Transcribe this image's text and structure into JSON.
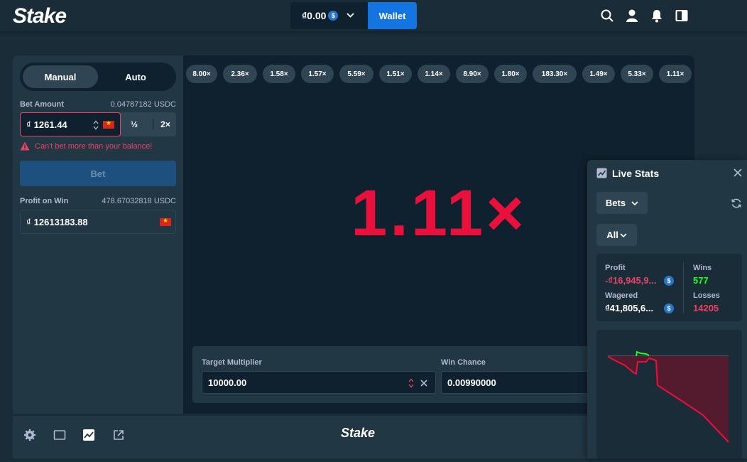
{
  "header": {
    "logo": "Stake",
    "balance": "₫0.00",
    "balance_coin": "$",
    "wallet_label": "Wallet"
  },
  "left_panel": {
    "mode_manual": "Manual",
    "mode_auto": "Auto",
    "bet_amount_label": "Bet Amount",
    "bet_amount_usdc": "0.04787182 USDC",
    "bet_currency_symbol": "₫",
    "bet_amount_value": "1261.44",
    "half_label": "½",
    "double_label": "2×",
    "error_text": "Can't bet more than your balance!",
    "bet_button": "Bet",
    "profit_label": "Profit on Win",
    "profit_usdc": "478.67032818 USDC",
    "profit_value": "12613183.88"
  },
  "game": {
    "recent_results": [
      "8.00×",
      "2.36×",
      "1.58×",
      "1.57×",
      "5.59×",
      "1.51×",
      "1.14×",
      "8.90×",
      "1.80×",
      "183.30×",
      "1.49×",
      "5.33×",
      "1.11×"
    ],
    "current_multiplier": "1.11×",
    "target_multiplier_label": "Target Multiplier",
    "target_multiplier_value": "10000.00",
    "win_chance_label": "Win Chance",
    "win_chance_value": "0.00990000"
  },
  "footer": {
    "logo": "Stake"
  },
  "live_stats": {
    "title": "Live Stats",
    "bets_dropdown": "Bets",
    "filter_dropdown": "All",
    "profit_label": "Profit",
    "profit_value": "-₫16,945,9...",
    "wagered_label": "Wagered",
    "wagered_value": "₫41,805,6...",
    "coin": "$",
    "wins_label": "Wins",
    "wins_value": "577",
    "losses_label": "Losses",
    "losses_value": "14205"
  },
  "colors": {
    "accent_red": "#e9113c",
    "win_green": "#1fff20",
    "loss_red": "#ed4163",
    "wallet_blue": "#1475e1"
  }
}
